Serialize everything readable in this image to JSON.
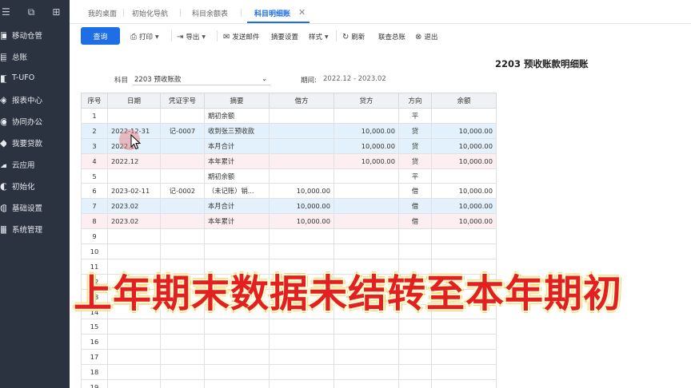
{
  "sidebar": {
    "top_icons": [
      "toggle-icon",
      "collapse-icon",
      "new-window-icon"
    ],
    "items": [
      {
        "label": "移动仓管",
        "icon": "mobile-warehouse-icon"
      },
      {
        "label": "总账",
        "icon": "ledger-icon"
      },
      {
        "label": "T-UFO",
        "icon": "tufo-icon"
      },
      {
        "label": "报表中心",
        "icon": "report-icon"
      },
      {
        "label": "协同办公",
        "icon": "collab-icon"
      },
      {
        "label": "我要贷款",
        "icon": "loan-icon"
      },
      {
        "label": "云应用",
        "icon": "cloud-app-icon"
      },
      {
        "label": "初始化",
        "icon": "init-icon"
      },
      {
        "label": "基础设置",
        "icon": "settings-icon"
      },
      {
        "label": "系统管理",
        "icon": "system-icon"
      }
    ]
  },
  "tabs": [
    {
      "label": "我的桌面",
      "active": false
    },
    {
      "label": "初始化导航",
      "active": false
    },
    {
      "label": "科目余额表",
      "active": false
    },
    {
      "label": "科目明细账",
      "active": true
    }
  ],
  "toolbar": {
    "query": "查询",
    "print": "打印",
    "export": "导出",
    "send_mail": "发送邮件",
    "summary_settings": "摘要设置",
    "style": "样式",
    "refresh": "刷新",
    "link_ledger": "联查总账",
    "exit": "退出"
  },
  "report": {
    "title": "2203 预收账款明细账",
    "subject_label": "科目",
    "subject_value": "2203 预收账款",
    "period_label": "期间:",
    "period_value": "2022.12 - 2023.02"
  },
  "table": {
    "headers": [
      "序号",
      "日期",
      "凭证字号",
      "摘要",
      "借方",
      "贷方",
      "方向",
      "余额"
    ],
    "rows": [
      {
        "no": "1",
        "date": "",
        "voucher": "",
        "summary": "期初余额",
        "debit": "",
        "credit": "",
        "dir": "平",
        "balance": "",
        "style": "plain"
      },
      {
        "no": "2",
        "date": "2022-12-31",
        "voucher": "记-0007",
        "summary": "收到张三预收款",
        "debit": "",
        "credit": "10,000.00",
        "dir": "贷",
        "balance": "10,000.00",
        "style": "blue"
      },
      {
        "no": "3",
        "date": "2022.1",
        "voucher": "",
        "summary": "本月合计",
        "debit": "",
        "credit": "10,000.00",
        "dir": "贷",
        "balance": "10,000.00",
        "style": "blue"
      },
      {
        "no": "4",
        "date": "2022.12",
        "voucher": "",
        "summary": "本年累计",
        "debit": "",
        "credit": "10,000.00",
        "dir": "贷",
        "balance": "10,000.00",
        "style": "pink"
      },
      {
        "no": "5",
        "date": "",
        "voucher": "",
        "summary": "期初余额",
        "debit": "",
        "credit": "",
        "dir": "平",
        "balance": "",
        "style": "plain"
      },
      {
        "no": "6",
        "date": "2023-02-11",
        "voucher": "记-0002",
        "summary": "（未记账）销...",
        "debit": "10,000.00",
        "credit": "",
        "dir": "借",
        "balance": "10,000.00",
        "style": "plain"
      },
      {
        "no": "7",
        "date": "2023.02",
        "voucher": "",
        "summary": "本月合计",
        "debit": "10,000.00",
        "credit": "",
        "dir": "借",
        "balance": "10,000.00",
        "style": "blue"
      },
      {
        "no": "8",
        "date": "2023.02",
        "voucher": "",
        "summary": "本年累计",
        "debit": "10,000.00",
        "credit": "",
        "dir": "借",
        "balance": "10,000.00",
        "style": "pink"
      },
      {
        "no": "9",
        "date": "",
        "voucher": "",
        "summary": "",
        "debit": "",
        "credit": "",
        "dir": "",
        "balance": "",
        "style": "plain"
      },
      {
        "no": "10",
        "date": "",
        "voucher": "",
        "summary": "",
        "debit": "",
        "credit": "",
        "dir": "",
        "balance": "",
        "style": "plain"
      },
      {
        "no": "11",
        "date": "",
        "voucher": "",
        "summary": "",
        "debit": "",
        "credit": "",
        "dir": "",
        "balance": "",
        "style": "plain"
      },
      {
        "no": "12",
        "date": "",
        "voucher": "",
        "summary": "",
        "debit": "",
        "credit": "",
        "dir": "",
        "balance": "",
        "style": "plain"
      },
      {
        "no": "13",
        "date": "",
        "voucher": "",
        "summary": "",
        "debit": "",
        "credit": "",
        "dir": "",
        "balance": "",
        "style": "plain"
      },
      {
        "no": "14",
        "date": "",
        "voucher": "",
        "summary": "",
        "debit": "",
        "credit": "",
        "dir": "",
        "balance": "",
        "style": "plain"
      },
      {
        "no": "15",
        "date": "",
        "voucher": "",
        "summary": "",
        "debit": "",
        "credit": "",
        "dir": "",
        "balance": "",
        "style": "plain"
      },
      {
        "no": "16",
        "date": "",
        "voucher": "",
        "summary": "",
        "debit": "",
        "credit": "",
        "dir": "",
        "balance": "",
        "style": "plain"
      },
      {
        "no": "17",
        "date": "",
        "voucher": "",
        "summary": "",
        "debit": "",
        "credit": "",
        "dir": "",
        "balance": "",
        "style": "plain"
      },
      {
        "no": "18",
        "date": "",
        "voucher": "",
        "summary": "",
        "debit": "",
        "credit": "",
        "dir": "",
        "balance": "",
        "style": "plain"
      },
      {
        "no": "19",
        "date": "",
        "voucher": "",
        "summary": "",
        "debit": "",
        "credit": "",
        "dir": "",
        "balance": "",
        "style": "plain"
      }
    ]
  },
  "overlay_caption": "上年期末数据未结转至本年期初",
  "colors": {
    "sidebar_bg": "#2b3240",
    "accent_blue": "#1e6ee6",
    "row_blue": "#e2f1fb",
    "row_pink": "#fdeff1",
    "caption_red": "#e32020"
  }
}
